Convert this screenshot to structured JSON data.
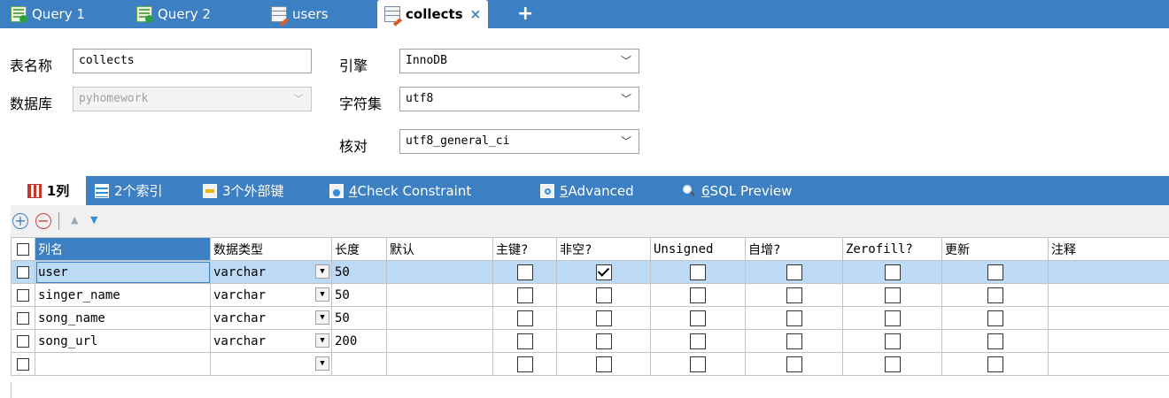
{
  "tabs": [
    {
      "label": "Query 1",
      "icon": "query-icon"
    },
    {
      "label": "Query 2",
      "icon": "query-icon"
    },
    {
      "label": "users",
      "icon": "table-icon"
    },
    {
      "label": "collects",
      "icon": "table-icon",
      "active": true,
      "close": "×"
    }
  ],
  "new_tab_label": "+",
  "form": {
    "table_name_label": "表名称",
    "table_name_value": "collects",
    "database_label": "数据库",
    "database_value": "pyhomework",
    "engine_label": "引擎",
    "engine_value": "InnoDB",
    "charset_label": "字符集",
    "charset_value": "utf8",
    "collation_label": "核对",
    "collation_value": "utf8_general_ci"
  },
  "subtabs": [
    {
      "num": "1",
      "text": " 列",
      "icon": "columns-icon"
    },
    {
      "num": "2",
      "text": " 个索引",
      "icon": "index-icon"
    },
    {
      "num": "3",
      "text": " 个外部键",
      "icon": "foreign-key-icon"
    },
    {
      "num": "4",
      "text": " Check Constraint",
      "icon": "check-constraint-icon"
    },
    {
      "num": "5",
      "text": " Advanced",
      "icon": "advanced-icon"
    },
    {
      "num": "6",
      "text": " SQL Preview",
      "icon": "sql-preview-icon"
    }
  ],
  "toolbar": {
    "add": "+",
    "remove": "−",
    "up": "▲",
    "down": "▼"
  },
  "columns": {
    "name": "列名",
    "type": "数据类型",
    "length": "长度",
    "default": "默认",
    "pk": "主键?",
    "notnull": "非空?",
    "unsigned": "Unsigned",
    "autoinc": "自增?",
    "zerofill": "Zerofill?",
    "update": "更新",
    "comment": "注释"
  },
  "rows": [
    {
      "name": "user",
      "type": "varchar",
      "length": "50",
      "notnull": true,
      "selected": true
    },
    {
      "name": "singer_name",
      "type": "varchar",
      "length": "50",
      "notnull": false
    },
    {
      "name": "song_name",
      "type": "varchar",
      "length": "50",
      "notnull": false
    },
    {
      "name": "song_url",
      "type": "varchar",
      "length": "200",
      "notnull": false
    },
    {
      "name": "",
      "type": "",
      "length": "",
      "notnull": false
    }
  ],
  "colors": {
    "accent": "#3c7fc3",
    "selected_row": "#bcd9f5"
  }
}
